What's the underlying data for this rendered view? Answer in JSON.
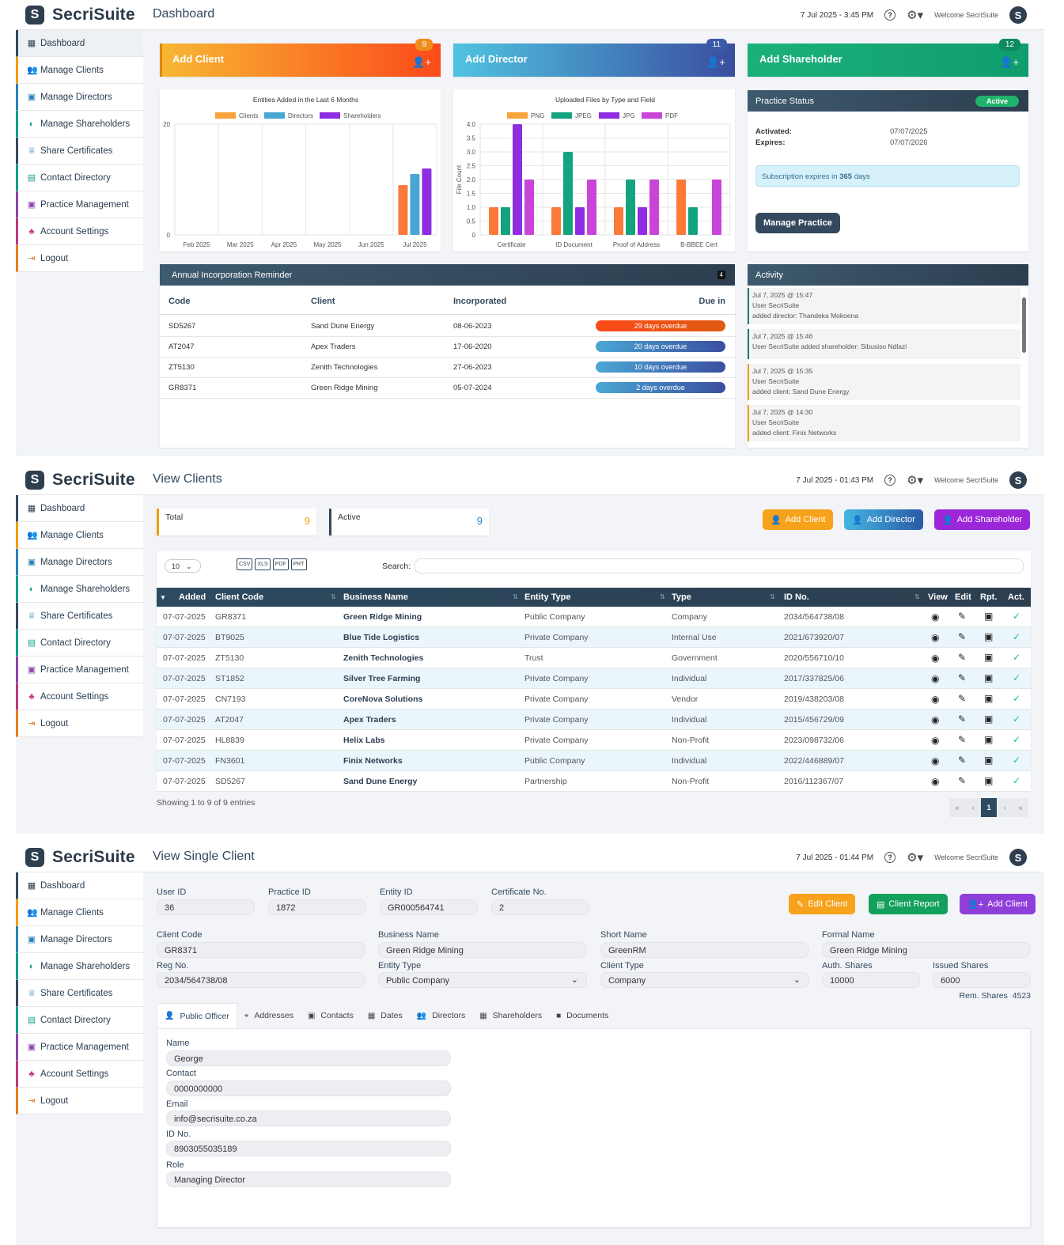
{
  "brand": {
    "name": "SecriSuite",
    "mark": "S"
  },
  "welcome": "Welcome SecriSuite",
  "sidebar": {
    "items": [
      "Dashboard",
      "Manage Clients",
      "Manage Directors",
      "Manage Shareholders",
      "Share Certificates",
      "Contact Directory",
      "Practice Management",
      "Account Settings",
      "Logout"
    ]
  },
  "screens": {
    "dashboard": {
      "title": "Dashboard",
      "datetime": "7 Jul 2025 - 3:45 PM"
    },
    "view_clients": {
      "title": "View Clients",
      "datetime": "7 Jul 2025 - 01:43 PM"
    },
    "single_client": {
      "title": "View Single Client",
      "datetime": "7 Jul 2025 - 01:44 PM"
    }
  },
  "dash": {
    "add_client": {
      "label": "Add Client",
      "count": "9"
    },
    "add_director": {
      "label": "Add Director",
      "count": "11"
    },
    "add_shareholder": {
      "label": "Add Shareholder",
      "count": "12"
    },
    "practice": {
      "title": "Practice Status",
      "badge": "Active",
      "activated_label": "Activated:",
      "activated": "07/07/2025",
      "expires_label": "Expires:",
      "expires": "07/07/2026",
      "sub_prefix": "Subscription expires in",
      "sub_days": "365",
      "sub_suffix": "days",
      "button": "Manage Practice"
    },
    "reminder": {
      "title": "Annual Incorporation Reminder",
      "count": "4",
      "headers": [
        "Code",
        "Client",
        "Incorporated",
        "Due in"
      ],
      "rows": [
        {
          "code": "SD5267",
          "client": "Sand Dune Energy",
          "date": "08-06-2023",
          "due": "29 days overdue"
        },
        {
          "code": "AT2047",
          "client": "Apex Traders",
          "date": "17-06-2020",
          "due": "20 days overdue"
        },
        {
          "code": "ZT5130",
          "client": "Zenith Technologies",
          "date": "27-06-2023",
          "due": "10 days overdue"
        },
        {
          "code": "GR8371",
          "client": "Green Ridge Mining",
          "date": "05-07-2024",
          "due": "2 days overdue"
        }
      ]
    },
    "activity": {
      "title": "Activity",
      "items": [
        {
          "time": "Jul 7, 2025 @ 15:47",
          "text": "User SecriSuite",
          "text2": "added director: Thandeka Mokoena",
          "color": "#1f7a5a"
        },
        {
          "time": "Jul 7, 2025 @ 15:46",
          "text": "User SecriSuite added shareholder: Sibusiso Ndlazi",
          "text2": "",
          "color": "#1f7a5a"
        },
        {
          "time": "Jul 7, 2025 @ 15:35",
          "text": "User SecriSuite",
          "text2": "added client: Sand Dune Energy",
          "color": "#f39c12"
        },
        {
          "time": "Jul 7, 2025 @ 14:30",
          "text": "User SecriSuite",
          "text2": "added client: Finix Networks",
          "color": "#f39c12"
        }
      ]
    }
  },
  "chart_data": [
    {
      "type": "bar",
      "title": "Entities Added in the Last 6 Months",
      "categories": [
        "Feb 2025",
        "Mar 2025",
        "Apr 2025",
        "May 2025",
        "Jun 2025",
        "Jul 2025"
      ],
      "series": [
        {
          "name": "Clients",
          "values": [
            0,
            0,
            0,
            0,
            0,
            9
          ],
          "color": "#f7a23a"
        },
        {
          "name": "Directors",
          "values": [
            0,
            0,
            0,
            0,
            0,
            11
          ],
          "color": "#4aa7d4"
        },
        {
          "name": "Shareholders",
          "values": [
            0,
            0,
            0,
            0,
            0,
            12
          ],
          "color": "#8e2de2"
        }
      ],
      "ylim": [
        0,
        20
      ],
      "yticks": [
        "0",
        "20"
      ],
      "legend": "top",
      "grid": true
    },
    {
      "type": "bar",
      "title": "Uploaded Files by Type and Field",
      "ylabel": "File Count",
      "categories": [
        "Certificate",
        "ID Document",
        "Proof of Address",
        "B-BBEE Cert"
      ],
      "series": [
        {
          "name": "PNG",
          "values": [
            1,
            1,
            1,
            2
          ],
          "color": "#f7a23a"
        },
        {
          "name": "JPEG",
          "values": [
            1,
            3,
            2,
            1
          ],
          "color": "#14a37f"
        },
        {
          "name": "JPG",
          "values": [
            4,
            1,
            1,
            0
          ],
          "color": "#8e2de2"
        },
        {
          "name": "PDF",
          "values": [
            2,
            2,
            2,
            2
          ],
          "color": "#c944d8"
        }
      ],
      "ylim": [
        0,
        4
      ],
      "yticks": [
        "0",
        "0.5",
        "1.0",
        "1.5",
        "2.0",
        "2.5",
        "3.0",
        "3.5",
        "4.0"
      ],
      "legend": "top",
      "grid": true
    }
  ],
  "clients_view": {
    "total_label": "Total",
    "total": "9",
    "active_label": "Active",
    "active": "9",
    "buttons": {
      "add_client": "Add Client",
      "add_director": "Add Director",
      "add_shareholder": "Add Shareholder"
    },
    "page_size": "10",
    "exports": [
      "CSV",
      "XLS",
      "PDF",
      "PRT"
    ],
    "search_label": "Search:",
    "headers": [
      "Added",
      "Client Code",
      "Business Name",
      "Entity Type",
      "Type",
      "ID No.",
      "View",
      "Edit",
      "Rpt.",
      "Act."
    ],
    "rows": [
      {
        "added": "07-07-2025",
        "code": "GR8371",
        "name": "Green Ridge Mining",
        "entity": "Public Company",
        "type": "Company",
        "id": "2034/564738/08"
      },
      {
        "added": "07-07-2025",
        "code": "BT9025",
        "name": "Blue Tide Logistics",
        "entity": "Private Company",
        "type": "Internal Use",
        "id": "2021/673920/07"
      },
      {
        "added": "07-07-2025",
        "code": "ZT5130",
        "name": "Zenith Technologies",
        "entity": "Trust",
        "type": "Government",
        "id": "2020/556710/10"
      },
      {
        "added": "07-07-2025",
        "code": "ST1852",
        "name": "Silver Tree Farming",
        "entity": "Private Company",
        "type": "Individual",
        "id": "2017/337825/06"
      },
      {
        "added": "07-07-2025",
        "code": "CN7193",
        "name": "CoreNova Solutions",
        "entity": "Private Company",
        "type": "Vendor",
        "id": "2019/438203/08"
      },
      {
        "added": "07-07-2025",
        "code": "AT2047",
        "name": "Apex Traders",
        "entity": "Private Company",
        "type": "Individual",
        "id": "2015/456729/09"
      },
      {
        "added": "07-07-2025",
        "code": "HL8839",
        "name": "Helix Labs",
        "entity": "Private Company",
        "type": "Non-Profit",
        "id": "2023/098732/06"
      },
      {
        "added": "07-07-2025",
        "code": "FN3601",
        "name": "Finix Networks",
        "entity": "Public Company",
        "type": "Individual",
        "id": "2022/446889/07"
      },
      {
        "added": "07-07-2025",
        "code": "SD5267",
        "name": "Sand Dune Energy",
        "entity": "Partnership",
        "type": "Non-Profit",
        "id": "2016/112367/07"
      }
    ],
    "showing": "Showing 1 to 9 of 9 entries",
    "pager": [
      "«",
      "‹",
      "1",
      "›",
      "»"
    ]
  },
  "single": {
    "user_id_label": "User ID",
    "user_id": "36",
    "practice_id_label": "Practice ID",
    "practice_id": "1872",
    "entity_id_label": "Entity ID",
    "entity_id": "GR000564741",
    "cert_label": "Certificate No.",
    "cert": "2",
    "buttons": {
      "edit": "Edit Client",
      "report": "Client Report",
      "add": "Add Client"
    },
    "client_code_label": "Client Code",
    "client_code": "GR8371",
    "business_name_label": "Business Name",
    "business_name": "Green Ridge Mining",
    "short_name_label": "Short Name",
    "short_name": "GreenRM",
    "formal_name_label": "Formal Name",
    "formal_name": "Green Ridge Mining",
    "reg_label": "Reg No.",
    "reg": "2034/564738/08",
    "entity_type_label": "Entity Type",
    "entity_type": "Public Company",
    "client_type_label": "Client Type",
    "client_type": "Company",
    "auth_label": "Auth. Shares",
    "auth": "10000",
    "issued_label": "Issued Shares",
    "issued": "6000",
    "rem_label": "Rem. Shares",
    "rem": "4523",
    "tabs": [
      "Public Officer",
      "Addresses",
      "Contacts",
      "Dates",
      "Directors",
      "Shareholders",
      "Documents"
    ],
    "officer": {
      "name_label": "Name",
      "name": "George",
      "contact_label": "Contact",
      "contact": "0000000000",
      "email_label": "Email",
      "email": "info@secrisuite.co.za",
      "id_label": "ID No.",
      "id": "8903055035189",
      "role_label": "Role",
      "role": "Managing Director"
    }
  }
}
